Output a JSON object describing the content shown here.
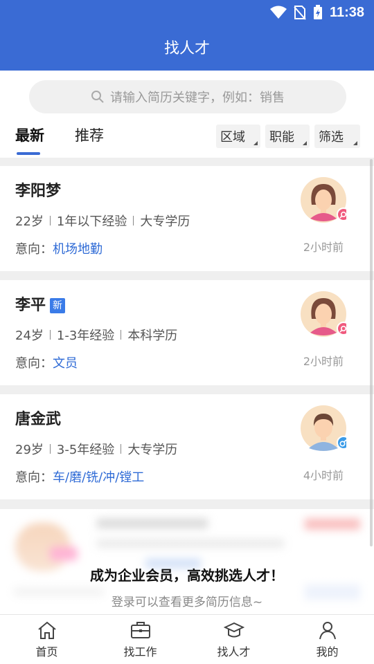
{
  "status_bar": {
    "time": "11:38"
  },
  "header": {
    "title": "找人才"
  },
  "search": {
    "placeholder": "请输入简历关键字，例如：销售"
  },
  "tabs": [
    {
      "label": "最新"
    },
    {
      "label": "推荐"
    }
  ],
  "filters": [
    {
      "label": "区域"
    },
    {
      "label": "职能"
    },
    {
      "label": "筛选"
    }
  ],
  "candidates": [
    {
      "name": "李阳梦",
      "age": "22岁",
      "experience": "1年以下经验",
      "education": "大专学历",
      "intent_label": "意向：",
      "intent": "机场地勤",
      "time": "2小时前",
      "gender_icon": "female-icon"
    },
    {
      "name": "李平",
      "badge": "新",
      "age": "24岁",
      "experience": "1-3年经验",
      "education": "本科学历",
      "intent_label": "意向：",
      "intent": "文员",
      "time": "2小时前",
      "gender_icon": "female-icon"
    },
    {
      "name": "唐金武",
      "age": "29岁",
      "experience": "3-5年经验",
      "education": "大专学历",
      "intent_label": "意向：",
      "intent": "车/磨/铣/冲/镗工",
      "time": "4小时前",
      "gender_icon": "male-icon"
    }
  ],
  "locked_prompt": {
    "title": "成为企业会员，高效挑选人才！",
    "subtitle": "登录可以查看更多简历信息~"
  },
  "bottom_nav": [
    {
      "label": "首页",
      "icon": "home-icon"
    },
    {
      "label": "找工作",
      "icon": "briefcase-icon"
    },
    {
      "label": "找人才",
      "icon": "graduation-cap-icon"
    },
    {
      "label": "我的",
      "icon": "person-icon"
    }
  ],
  "colors": {
    "brand": "#3a6bd4",
    "accent_text": "#2f6bd6",
    "female_badge": "#f05a7e",
    "male_badge": "#3a9be8"
  }
}
